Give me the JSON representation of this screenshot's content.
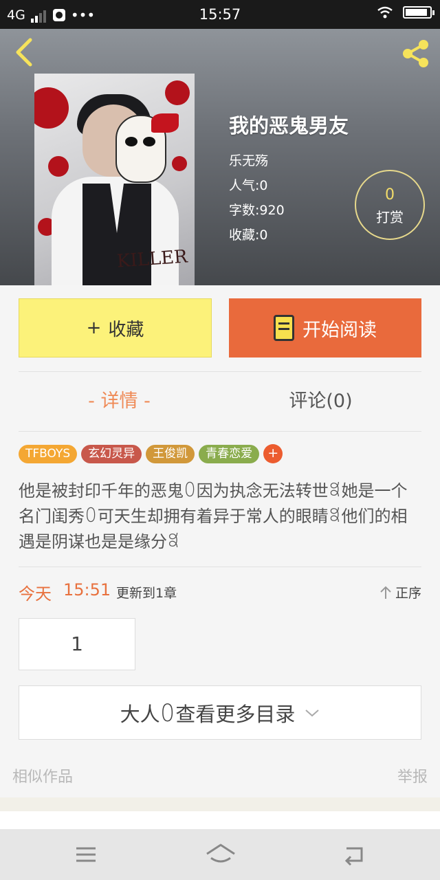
{
  "status_bar": {
    "network": "4G",
    "time": "15:57",
    "signal_level": 2,
    "battery_level": 0.9
  },
  "book": {
    "title": "我的恶鬼男友",
    "author": "乐无殇",
    "popularity": "人气:0",
    "word_count": "字数:920",
    "favorites": "收藏:0",
    "cover_text": "KILLER"
  },
  "reward": {
    "count": "0",
    "label": "打赏"
  },
  "actions": {
    "collect_label": "收藏",
    "collect_prefix": "+",
    "read_label": "开始阅读"
  },
  "tabs": [
    {
      "label": "- 详情 -"
    },
    {
      "label": "评论(0)"
    }
  ],
  "tags": [
    {
      "label": "TFBOYS",
      "color": "#f4a733"
    },
    {
      "label": "玄幻灵异",
      "color": "#c8584b"
    },
    {
      "label": "王俊凯",
      "color": "#d1983a"
    },
    {
      "label": "青春恋爱",
      "color": "#8aac4d"
    }
  ],
  "tag_more": "+",
  "description": "他是被封印千年的恶鬼ꄲ因为执念无法转世ꎿ她是一个名门闺秀ꄲ可天生却拥有着异于常人的眼睛ꎿ他们的相遇是阴谋也是是缘分ꎿ",
  "update": {
    "day": "今天",
    "time": "15:51",
    "info": "更新到1章",
    "sort_label": "正序"
  },
  "chapter_number": "1",
  "more_catalog_label": "大人ꄲ查看更多目录",
  "footer": {
    "similar_works": "相似作品",
    "report": "举报"
  },
  "colors": {
    "accent_orange": "#e96a3c",
    "collect_yellow": "#fcf27a",
    "reward_gold": "#f2dc6a"
  }
}
